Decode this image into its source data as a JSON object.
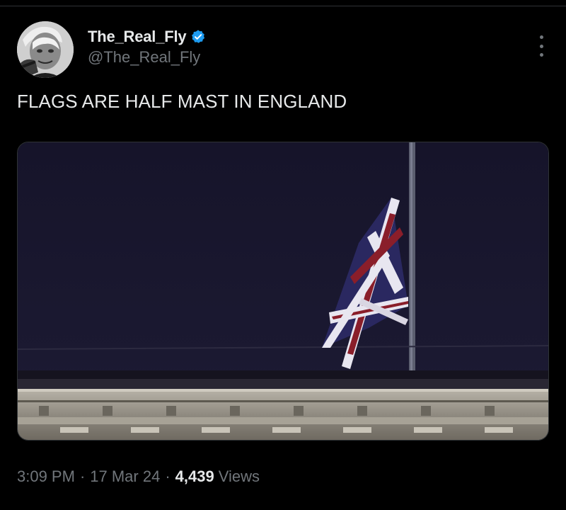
{
  "tweet": {
    "author": {
      "display_name": "The_Real_Fly",
      "handle": "@The_Real_Fly",
      "verified": true
    },
    "text": "FLAGS ARE HALF MAST IN ENGLAND",
    "time": "3:09 PM",
    "separator": "·",
    "date": "17 Mar 24",
    "views_count": "4,439",
    "views_label": "Views"
  },
  "icons": {
    "verified": "verified-badge-icon",
    "more": "more-options-icon"
  },
  "colors": {
    "background": "#000000",
    "text_primary": "#e7e9ea",
    "text_secondary": "#71767b",
    "verified_blue": "#1d9bf0",
    "divider": "#2f3336"
  }
}
